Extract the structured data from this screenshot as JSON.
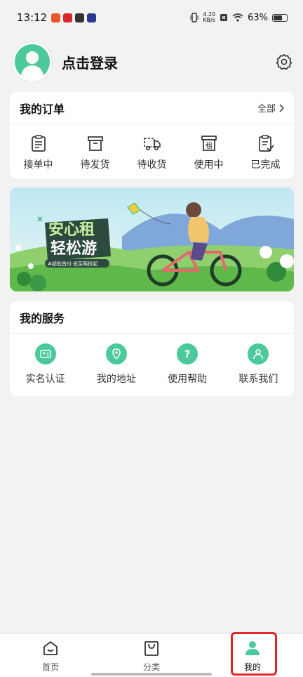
{
  "status_bar": {
    "time": "13:12",
    "net_speed_value": "4.20",
    "net_speed_unit": "KB/s",
    "battery": "63%"
  },
  "profile": {
    "login_label": "点击登录"
  },
  "orders": {
    "title": "我的订单",
    "more_label": "全部",
    "items": [
      {
        "label": "接单中",
        "icon": "clipboard-icon"
      },
      {
        "label": "待发货",
        "icon": "box-icon"
      },
      {
        "label": "待收货",
        "icon": "truck-icon"
      },
      {
        "label": "使用中",
        "icon": "rent-icon",
        "glyph": "租"
      },
      {
        "label": "已完成",
        "icon": "check-clipboard-icon"
      }
    ]
  },
  "banner": {
    "headline_1": "安心租",
    "headline_2": "轻松游",
    "tagline": "#超低首付 低至两折起"
  },
  "services": {
    "title": "我的服务",
    "items": [
      {
        "label": "实名认证",
        "icon": "id-card-icon"
      },
      {
        "label": "我的地址",
        "icon": "location-pin-icon"
      },
      {
        "label": "使用帮助",
        "icon": "help-icon",
        "glyph": "?"
      },
      {
        "label": "联系我们",
        "icon": "contact-icon"
      }
    ]
  },
  "nav": {
    "items": [
      {
        "label": "首页",
        "icon": "home-icon"
      },
      {
        "label": "分类",
        "icon": "bag-icon"
      },
      {
        "label": "我的",
        "icon": "user-icon",
        "active": true
      }
    ]
  },
  "colors": {
    "accent": "#4cc99a",
    "highlight": "#e0262b",
    "background": "#f2f2f2"
  }
}
